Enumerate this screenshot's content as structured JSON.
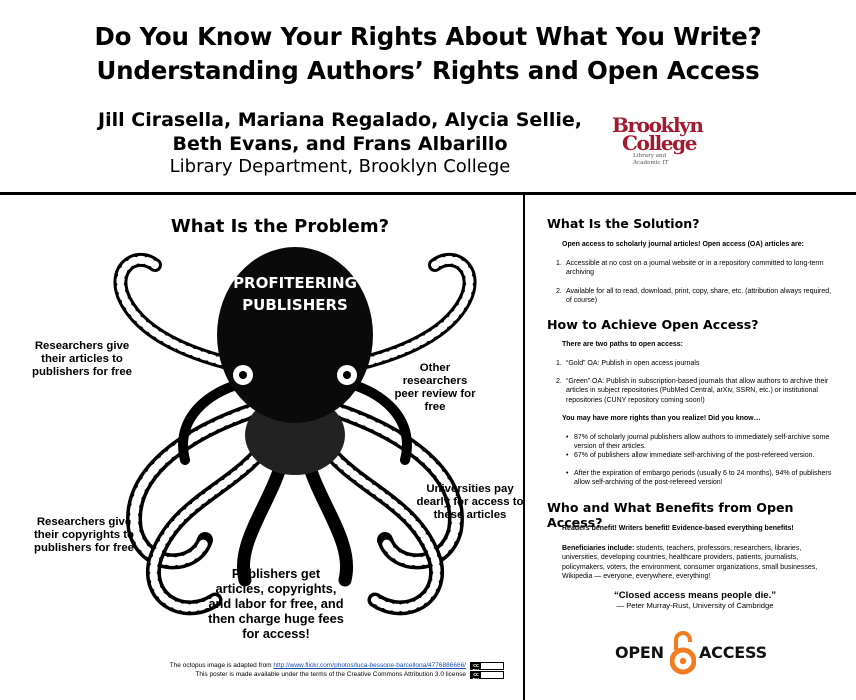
{
  "header": {
    "title_line1": "Do You Know Your Rights About What You Write?",
    "title_line2": "Understanding Authors’ Rights and Open Access",
    "authors_line1": "Jill Cirasella, Mariana Regalado, Alycia Sellie,",
    "authors_line2": "Beth Evans, and Frans Albarillo",
    "department": "Library Department, Brooklyn College",
    "logo": {
      "line1": "Brooklyn",
      "line2": "College",
      "line3": "Library and",
      "line4": "Academic IT",
      "color": "#a31a2e"
    }
  },
  "problem": {
    "title": "What Is the Problem?",
    "octopus_label_line1": "PROFITEERING",
    "octopus_label_line2": "PUBLISHERS",
    "callouts": [
      "Researchers give their articles to publishers for free",
      "Other researchers peer review for free",
      "Universities pay dearly for access to these articles",
      "Researchers give their copyrights to publishers for free",
      "Publishers get articles, copyrights, and labor for free, and then charge huge fees for access!"
    ],
    "credit_prefix": "The octopus image is adapted from ",
    "credit_link": "http://www.flickr.com/photos/luca-bessone-barcellona/4776886666/",
    "license_line": "This poster is made available under the terms of the Creative Commons Attribution 3.0 license",
    "cc_badge": "cc BY"
  },
  "solution": {
    "title": "What Is the Solution?",
    "intro": "Open access to scholarly journal articles!  Open access (OA) articles are:",
    "items": [
      "Accessible at no cost on a journal website or in a repository committed to long-term archiving",
      "Available for all to read, download, print, copy, share, etc. (attribution always required, of course)"
    ]
  },
  "achieve": {
    "title": "How to Achieve Open Access?",
    "intro": "There are two paths to open access:",
    "items": [
      "“Gold” OA: Publish in open access journals",
      "“Green” OA: Publish in subscription-based journals that allow authors to archive their articles in subject repositories (PubMed Central, arXiv, SSRN, etc.) or institutional repositories (CUNY repository coming soon!)"
    ],
    "rights_intro": "You may have more rights than you realize!  Did you know…",
    "bullets": [
      "87% of scholarly journal publishers allow authors to immediately self-archive some version of their articles.",
      "67% of publishers allow immediate self-archiving of the post-refereed version.",
      "After the expiration of embargo periods (usually 6 to 24 months), 94% of publishers allow self-archiving of the post-refereed version!"
    ]
  },
  "benefits": {
    "title": "Who and What Benefits from Open Access?",
    "line1": "Readers benefit!  Writers benefit!  Evidence-based everything benefits!",
    "beneficiaries_label": "Beneficiaries include:",
    "beneficiaries_text": " students, teachers, professors, researchers, libraries, universities, developing countries, healthcare providers, patients, journalists, policymakers, voters, the environment, consumer organizations, small businesses, Wikipedia — everyone, everywhere, everything!",
    "quote": "“Closed access means people die.”",
    "quote_attribution": "— Peter Murray-Rust, University of Cambridge",
    "oa_logo_left": "OPEN",
    "oa_logo_right": "ACCESS",
    "oa_color": "#f47c20"
  }
}
